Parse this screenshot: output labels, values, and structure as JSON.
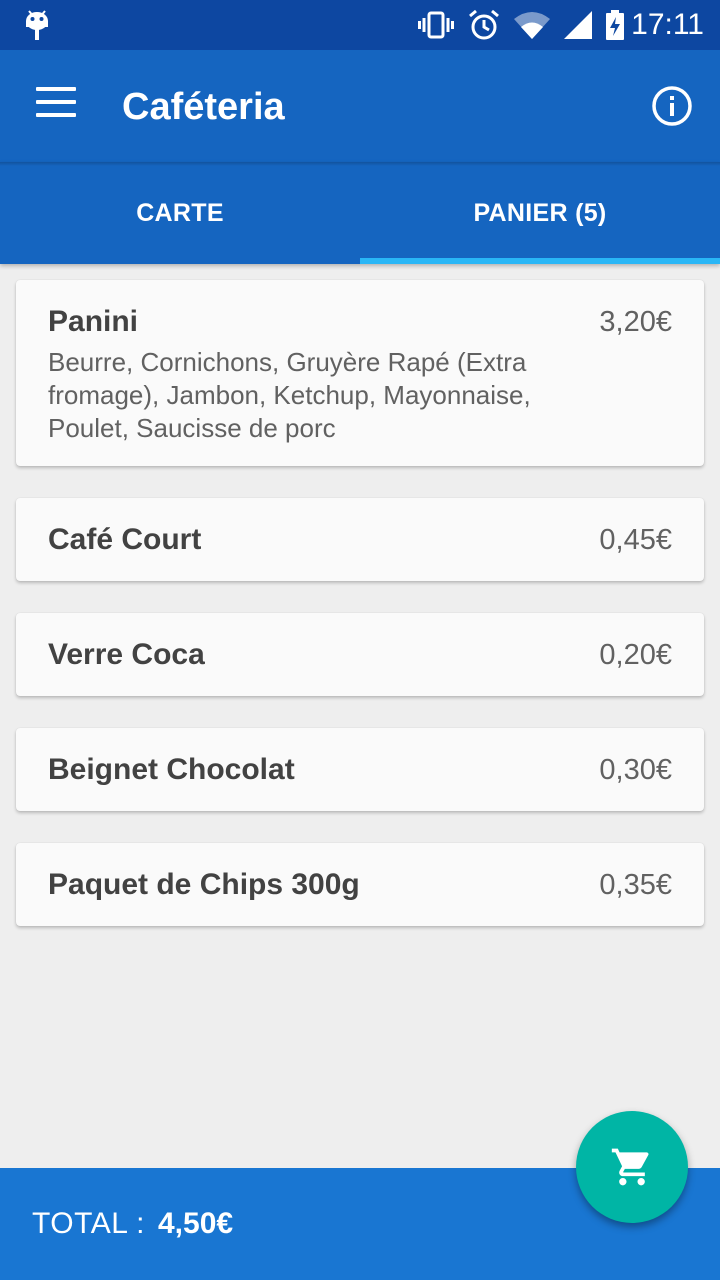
{
  "status_bar": {
    "time": "17:11",
    "icons": [
      "android-icon",
      "vibrate-icon",
      "alarm-icon",
      "wifi-icon",
      "signal-icon",
      "battery-charging-icon"
    ]
  },
  "app_bar": {
    "title": "Caféteria",
    "menu_icon": "hamburger-menu-icon",
    "info_icon": "info-icon"
  },
  "tabs": [
    {
      "label": "CARTE",
      "selected": false
    },
    {
      "label": "PANIER (5)",
      "selected": true
    }
  ],
  "cart_items": [
    {
      "name": "Panini",
      "price": "3,20€",
      "description": "Beurre, Cornichons, Gruyère Rapé (Extra fromage), Jambon, Ketchup, Mayonnaise, Poulet, Saucisse de porc"
    },
    {
      "name": "Café Court",
      "price": "0,45€"
    },
    {
      "name": "Verre Coca",
      "price": "0,20€"
    },
    {
      "name": "Beignet Chocolat",
      "price": "0,30€"
    },
    {
      "name": "Paquet de Chips 300g",
      "price": "0,35€"
    }
  ],
  "footer": {
    "total_label": "TOTAL :",
    "total_value": "4,50€"
  },
  "fab": {
    "icon": "shopping-cart-icon"
  },
  "colors": {
    "status_bar": "#0d47a1",
    "primary": "#1565c0",
    "tab_indicator": "#29b6f6",
    "fab": "#00b5a5",
    "background": "#eeeeee"
  }
}
